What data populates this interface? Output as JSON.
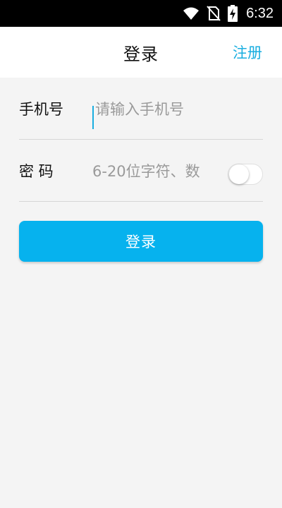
{
  "status_bar": {
    "time": "6:32",
    "icons": [
      "wifi-icon",
      "no-sim-icon",
      "battery-charging-icon"
    ]
  },
  "app_bar": {
    "title": "登录",
    "register_label": "注册"
  },
  "form": {
    "phone": {
      "label": "手机号",
      "placeholder": "请输入手机号",
      "value": ""
    },
    "password": {
      "label": "密 码",
      "placeholder": "6-20位字符、数",
      "value": "",
      "show_password_toggle": false
    }
  },
  "login_button": {
    "label": "登录"
  },
  "colors": {
    "accent": "#19aee0",
    "button": "#06b2ee",
    "background": "#f4f4f4"
  }
}
